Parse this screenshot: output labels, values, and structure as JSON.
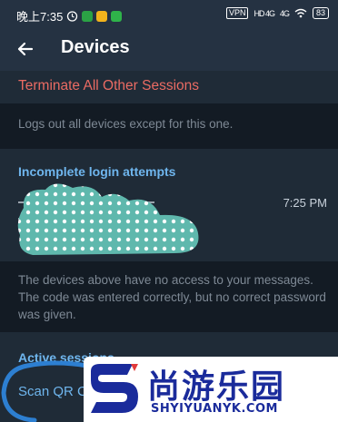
{
  "status_bar": {
    "time": "晚上7:35",
    "vpn": "VPN",
    "signal_1": "HD 4G",
    "signal_2": "4G",
    "battery": "83"
  },
  "header": {
    "title": "Devices",
    "back_icon": "arrow-left-icon"
  },
  "terminate": {
    "label": "Terminate All Other Sessions",
    "color": "#ea6b63"
  },
  "terminate_info": "Logs out all devices except for this one.",
  "incomplete": {
    "title": "Incomplete login attempts",
    "time": "7:25 PM"
  },
  "incomplete_info": "The devices above have no access to your messages. The code was entered correctly, but no correct password was given.",
  "active": {
    "title": "Active sessions",
    "scan_label": "Scan QR Code"
  },
  "watermark": {
    "chinese": "尚游乐园",
    "english": "SHYIYUANYK.COM",
    "logo": "S"
  },
  "colors": {
    "accent": "#6fb6ee",
    "danger": "#ea6b63",
    "background": "#1b2733"
  }
}
